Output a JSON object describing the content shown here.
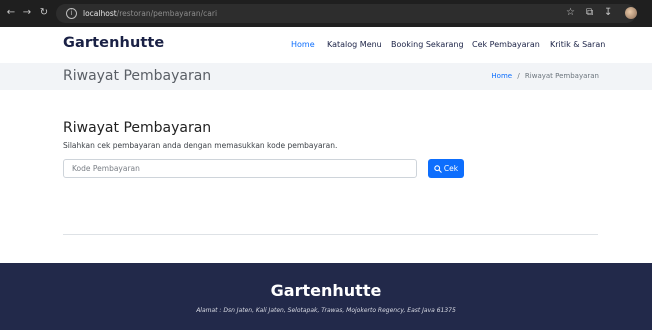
{
  "browser": {
    "url_host": "localhost",
    "url_path": "/restoran/pembayaran/cari",
    "back_icon": "arrow-left-icon",
    "forward_icon": "arrow-right-icon",
    "reload_icon": "reload-icon",
    "site_info_icon": "info-icon"
  },
  "header": {
    "brand": "Gartenhutte",
    "nav": [
      {
        "label": "Home",
        "active": true
      },
      {
        "label": "Katalog Menu",
        "active": false
      },
      {
        "label": "Booking Sekarang",
        "active": false
      },
      {
        "label": "Cek Pembayaran",
        "active": false
      },
      {
        "label": "Kritik & Saran",
        "active": false
      }
    ]
  },
  "band": {
    "title": "Riwayat Pembayaran",
    "breadcrumb": {
      "home": "Home",
      "separator": "/",
      "current": "Riwayat Pembayaran"
    }
  },
  "main": {
    "title": "Riwayat Pembayaran",
    "subtitle": "Silahkan cek pembayaran anda dengan memasukkan kode pembayaran.",
    "input": {
      "placeholder": "Kode Pembayaran",
      "value": ""
    },
    "button": {
      "label": "Cek",
      "icon": "search-icon"
    }
  },
  "footer": {
    "brand": "Gartenhutte",
    "address": "Alamat : Dsn Jaten, Kali Jaten, Selotapak, Trawas, Mojokerto Regency, East Java 61375"
  },
  "colors": {
    "accent": "#0d6efd",
    "navy": "#22294a",
    "band_bg": "#f2f4f7"
  }
}
